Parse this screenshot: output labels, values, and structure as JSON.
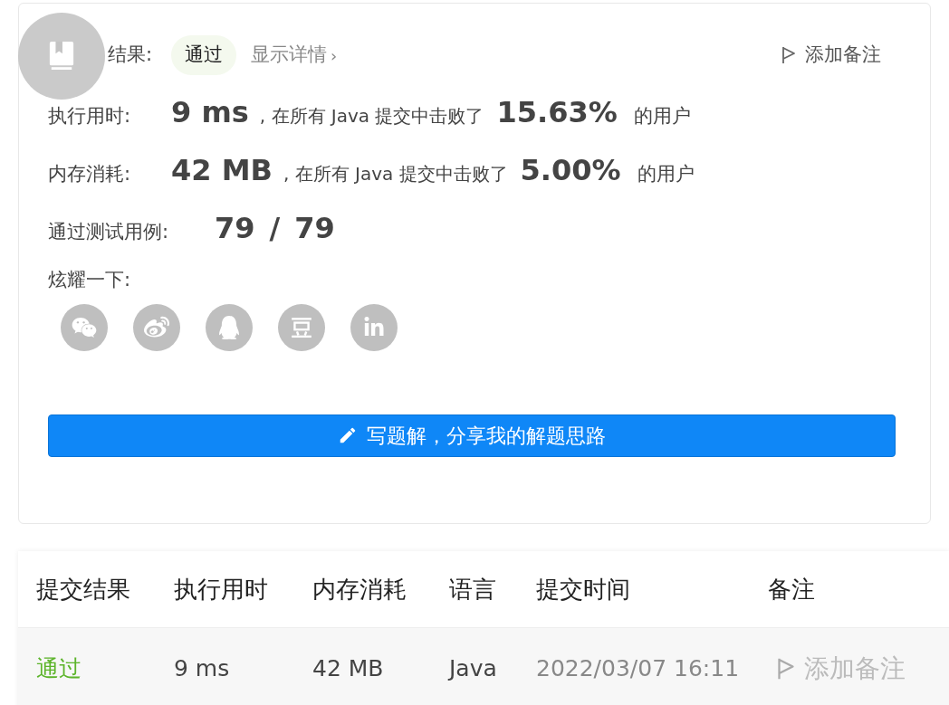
{
  "result": {
    "label": "结果:",
    "status": "通过",
    "details_link": "显示详情",
    "details_chevron": "›",
    "add_note": "添加备注"
  },
  "stats": [
    {
      "label": "执行用时:",
      "value": "9 ms",
      "text": ", 在所有 Java 提交中击败了",
      "percent": "15.63%",
      "suffix": "的用户"
    },
    {
      "label": "内存消耗:",
      "value": "42 MB",
      "text": ", 在所有 Java 提交中击败了",
      "percent": "5.00%",
      "suffix": "的用户"
    }
  ],
  "tests": {
    "label": "通过测试用例:",
    "passed": "79",
    "separator": "/",
    "total": "79"
  },
  "share": {
    "label": "炫耀一下:",
    "icons": [
      {
        "kind": "wechat"
      },
      {
        "kind": "weibo"
      },
      {
        "kind": "qq"
      },
      {
        "kind": "douban"
      },
      {
        "kind": "linkedin"
      }
    ]
  },
  "write_button": "写题解，分享我的解题思路",
  "table": {
    "columns": [
      "提交结果",
      "执行用时",
      "内存消耗",
      "语言",
      "提交时间",
      "备注"
    ],
    "rows": [
      {
        "status": "通过",
        "time": "9 ms",
        "memory": "42 MB",
        "language": "Java",
        "submitted": "2022/03/07 16:11",
        "note": "添加备注"
      }
    ]
  }
}
